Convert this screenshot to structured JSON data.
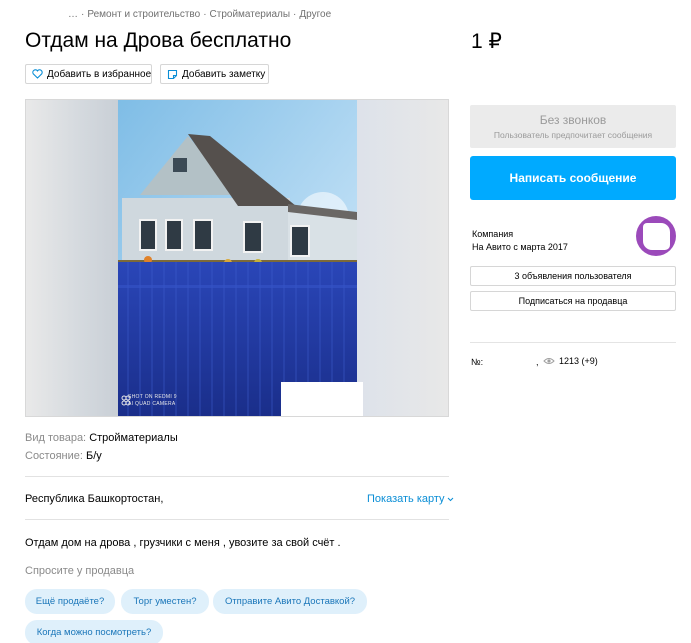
{
  "breadcrumb": {
    "items": [
      "…",
      "Ремонт и строительство",
      "Стройматериалы",
      "Другое"
    ]
  },
  "listing": {
    "title": "Отдам на Дрова бесплатно",
    "price": "1 ₽"
  },
  "actions": {
    "favorite_label": "Добавить в избранное",
    "note_label": "Добавить заметку"
  },
  "gallery": {
    "watermark_line1": "SHOT ON REDMI 9",
    "watermark_line2": "AI QUAD CAMERA"
  },
  "params": [
    {
      "key": "Вид товара:",
      "value": "Стройматериалы"
    },
    {
      "key": "Состояние:",
      "value": "Б/у"
    }
  ],
  "location": {
    "address": "Республика Башкортостан,",
    "map_link": "Показать карту"
  },
  "description": "Отдам дом на дрова , грузчики с меня , увозите за свой счёт .",
  "questions": {
    "heading": "Спросите у продавца",
    "chips": [
      "Ещё продаёте?",
      "Торг уместен?",
      "Отправите Авито Доставкой?",
      "Когда можно посмотреть?"
    ]
  },
  "contact": {
    "no_calls_title": "Без звонков",
    "no_calls_subtitle": "Пользователь предпочитает сообщения",
    "write_button": "Написать сообщение"
  },
  "seller": {
    "kind": "Компания",
    "since": "На Авито с марта 2017",
    "listings_button": "3 объявления пользователя",
    "subscribe_button": "Подписаться на продавца",
    "avatar_color": "#9b4aba"
  },
  "meta": {
    "number_label": "№:",
    "comma": ",",
    "views": "1213 (+9)"
  },
  "colors": {
    "accent": "#00aaff",
    "link": "#0a8ed6",
    "chip_bg": "#dff0fb",
    "chip_text": "#1a76b9"
  }
}
